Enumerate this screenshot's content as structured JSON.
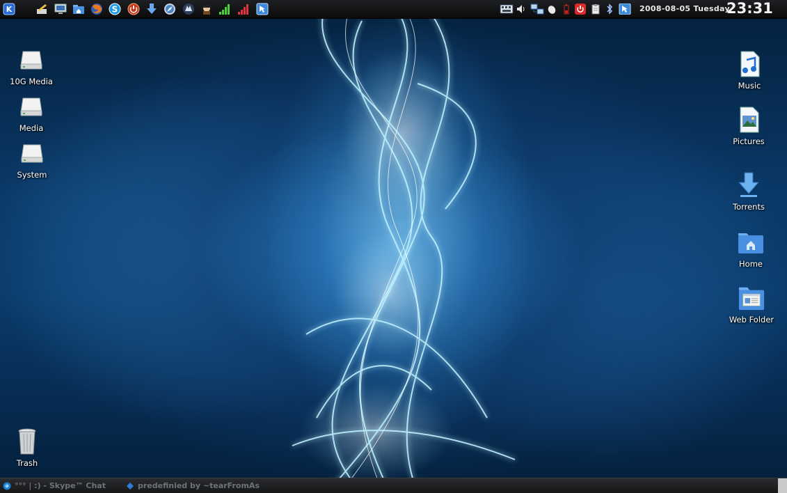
{
  "top_panel": {
    "date": "2008-08-05 Tuesday",
    "time": "23:31",
    "launchers": [
      "kde-menu-icon",
      "pencil-icon",
      "monitor-icon",
      "home-folder-icon",
      "firefox-icon",
      "skype-icon",
      "power-app-icon",
      "download-icon",
      "safari-icon",
      "wolf-icon",
      "pirate-icon",
      "signal-bars-green-icon",
      "signal-bars-red-icon",
      "kde-cursor-icon"
    ],
    "tray": [
      "keyboard-icon",
      "volume-icon",
      "network-icon",
      "mouse-icon",
      "battery-icon",
      "power-icon",
      "clipboard-icon",
      "bluetooth-icon",
      "kde-cursor-tray-icon"
    ]
  },
  "desktop_left": [
    {
      "label": "10G Media",
      "icon": "drive-icon"
    },
    {
      "label": "Media",
      "icon": "drive-icon"
    },
    {
      "label": "System",
      "icon": "drive-icon"
    }
  ],
  "desktop_right": [
    {
      "label": "Music",
      "icon": "music-icon"
    },
    {
      "label": "Pictures",
      "icon": "pictures-icon"
    },
    {
      "label": "Torrents",
      "icon": "torrents-icon"
    },
    {
      "label": "Home",
      "icon": "home-icon"
    },
    {
      "label": "Web Folder",
      "icon": "web-folder-icon"
    }
  ],
  "trash": {
    "label": "Trash"
  },
  "taskbar": [
    {
      "label": "°°° | :) - Skype™ Chat",
      "icon": "skype-chat-icon"
    },
    {
      "label": "predefinied by ~tearFromAs",
      "icon": "kde-window-icon"
    }
  ]
}
